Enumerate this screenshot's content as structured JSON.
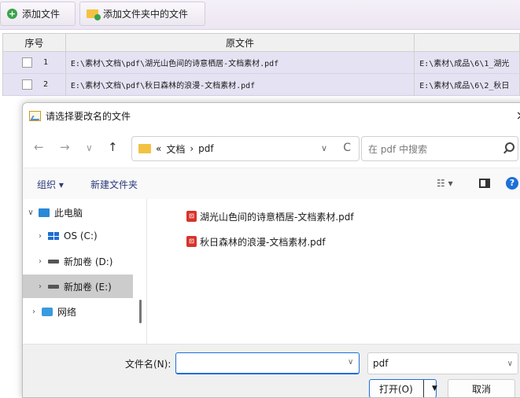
{
  "toolbar": {
    "add_file_label": "添加文件",
    "add_folder_label": "添加文件夹中的文件"
  },
  "table": {
    "headers": [
      "序号",
      "原文件",
      ""
    ],
    "rows": [
      {
        "index": "1",
        "source": "E:\\素材\\文档\\pdf\\湖光山色间的诗意栖居-文档素材.pdf",
        "target": "E:\\素材\\成品\\6\\1_湖光"
      },
      {
        "index": "2",
        "source": "E:\\素材\\文档\\pdf\\秋日森林的浪漫-文档素材.pdf",
        "target": "E:\\素材\\成品\\6\\2_秋日"
      }
    ]
  },
  "dialog": {
    "title": "请选择要改名的文件",
    "close_glyph": "×",
    "nav": {
      "back": "←",
      "forward": "→",
      "recent": "∨",
      "up": "↑"
    },
    "address": {
      "prefix": "«",
      "segment1": "文档",
      "separator": "›",
      "segment2": "pdf",
      "chevron": "∨",
      "refresh": "C"
    },
    "search_placeholder": "在 pdf 中搜索",
    "commands": {
      "organize": "组织 ▾",
      "new_folder": "新建文件夹",
      "view": "☷ ▾",
      "help": "?"
    },
    "tree": [
      {
        "arrow": "∨",
        "label": "此电脑",
        "icon": "pc-icon"
      },
      {
        "arrow": "›",
        "label": "OS (C:)",
        "icon": "windows-drive-icon"
      },
      {
        "arrow": "›",
        "label": "新加卷 (D:)",
        "icon": "drive-icon"
      },
      {
        "arrow": "›",
        "label": "新加卷 (E:)",
        "icon": "drive-icon",
        "selected": true
      },
      {
        "arrow": "›",
        "label": "网络",
        "icon": "network-icon"
      }
    ],
    "files": [
      {
        "name": "湖光山色间的诗意栖居-文档素材.pdf",
        "icon": "pdf-icon"
      },
      {
        "name": "秋日森林的浪漫-文档素材.pdf",
        "icon": "pdf-icon"
      }
    ],
    "filename_label": "文件名(N):",
    "filename_value": "",
    "filetype_value": "pdf",
    "open_label": "打开(O)",
    "cancel_label": "取消"
  },
  "colors": {
    "accent": "#1e6fd9",
    "row_bg": "#e5e3f3",
    "folder": "#f3c243",
    "pdf": "#d8332c"
  }
}
